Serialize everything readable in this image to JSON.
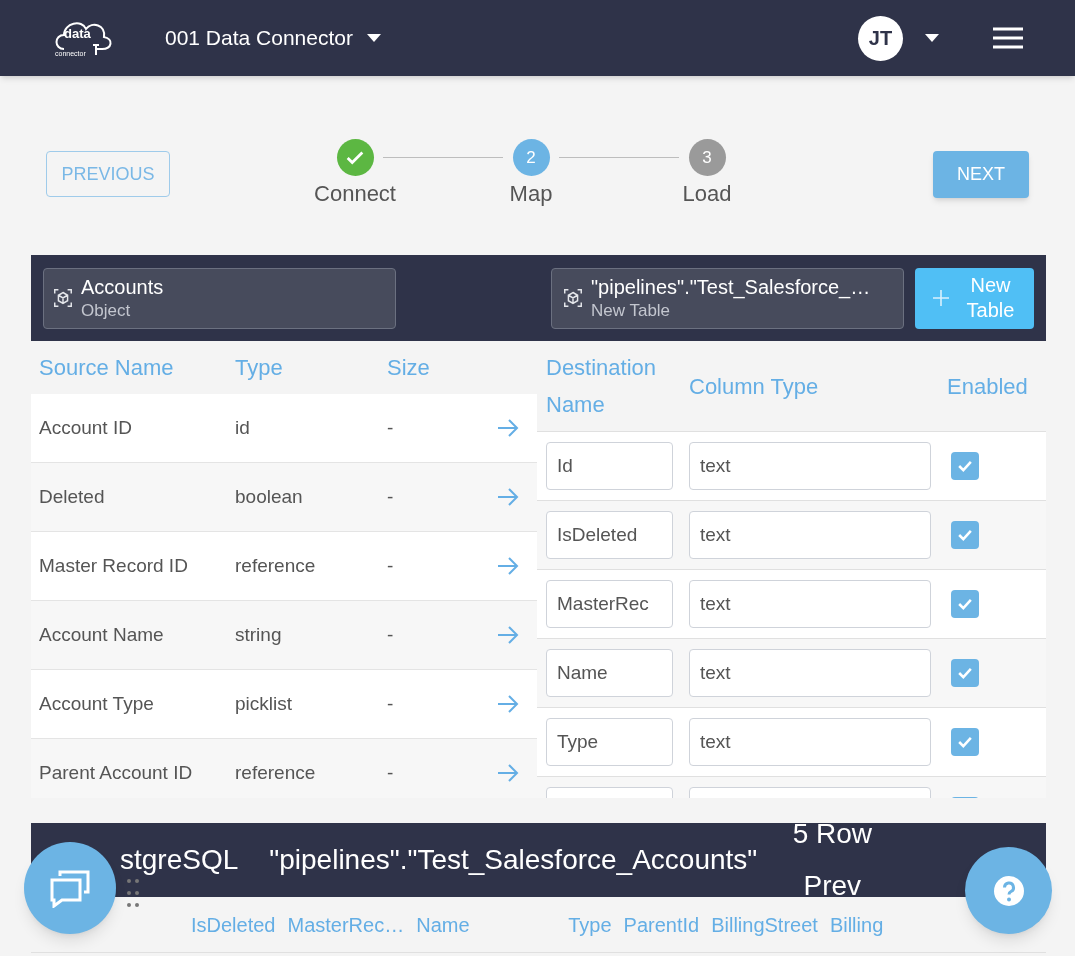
{
  "header": {
    "logo_text": "data",
    "logo_subtext": "connector",
    "app_title": "001 Data Connector",
    "avatar": "JT"
  },
  "stepper": {
    "previous": "PREVIOUS",
    "next": "NEXT",
    "steps": [
      {
        "label": "Connect",
        "completed": true,
        "selected": false
      },
      {
        "label": "Map",
        "number": "2",
        "completed": false,
        "selected": true
      },
      {
        "label": "Load",
        "number": "3",
        "completed": false,
        "selected": false
      }
    ]
  },
  "source": {
    "name": "Accounts",
    "subtitle": "Object"
  },
  "destination": {
    "name": "\"pipelines\".\"Test_Salesforce_…",
    "subtitle": "New Table",
    "new_table_button": "New Table"
  },
  "source_columns": [
    "Source Name",
    "Type",
    "Size"
  ],
  "source_rows": [
    {
      "name": "Account ID",
      "type": "id",
      "size": "-"
    },
    {
      "name": "Deleted",
      "type": "boolean",
      "size": "-"
    },
    {
      "name": "Master Record ID",
      "type": "reference",
      "size": "-"
    },
    {
      "name": "Account Name",
      "type": "string",
      "size": "-"
    },
    {
      "name": "Account Type",
      "type": "picklist",
      "size": "-"
    },
    {
      "name": "Parent Account ID",
      "type": "reference",
      "size": "-"
    }
  ],
  "destination_columns": [
    "Destination Name",
    "Column Type",
    "Enabled"
  ],
  "destination_rows": [
    {
      "name": "Id",
      "type": "text",
      "enabled": true
    },
    {
      "name": "IsDeleted",
      "type": "text",
      "enabled": true
    },
    {
      "name": "MasterRec",
      "type": "text",
      "enabled": true
    },
    {
      "name": "Name",
      "type": "text",
      "enabled": true
    },
    {
      "name": "Type",
      "type": "text",
      "enabled": true
    },
    {
      "enabled": true
    }
  ],
  "preview": {
    "source": "stgreSQL",
    "table": "\"pipelines\".\"Test_Salesforce_Accounts\"",
    "title": "5 Row Prev",
    "columns": [
      "IsDeleted",
      "MasterRec…",
      "Name",
      "Type",
      "ParentId",
      "BillingStreet",
      "Billing"
    ]
  }
}
